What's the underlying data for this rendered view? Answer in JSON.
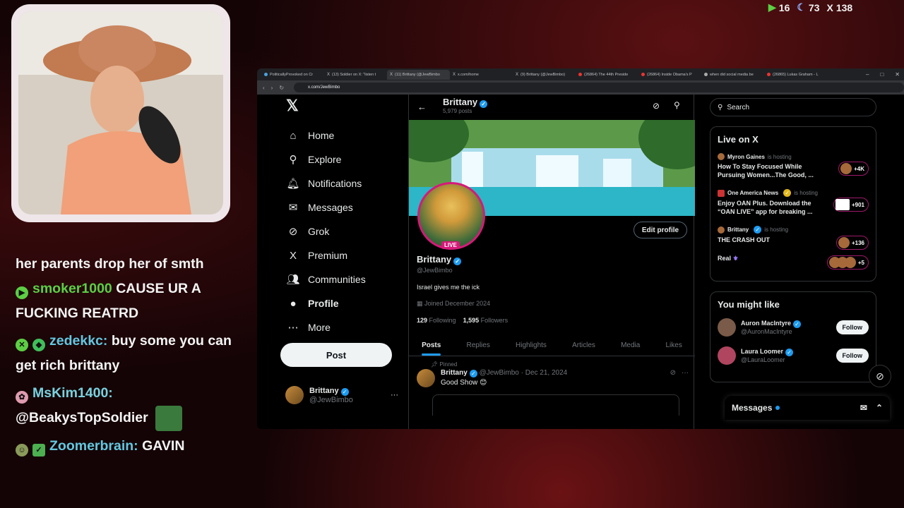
{
  "stats": {
    "a": "16",
    "b": "73",
    "c": "138"
  },
  "chat": [
    {
      "text": "her parents drop her of smth"
    },
    {
      "user": "smoker1000",
      "text": "CAUSE UR A FUCKING REATRD",
      "color": "#5ccf44"
    },
    {
      "user": "zedekkc:",
      "text": "buy some you can get rich brittany",
      "color": "#63c7e0"
    },
    {
      "user": "MsKim1400:",
      "text": "@BeakysTopSoldier",
      "color": "#7ad1de"
    },
    {
      "user": "Zoomerbrain:",
      "text": "GAVIN",
      "color": "#63c7e0"
    }
  ],
  "tabs": [
    "PoliticallyProvoked on Cr",
    "(13) Soldier on X: \"listen t",
    "(11) Brittany (@JewBimbo",
    "x.com/home",
    "(9) Brittany (@JewBimbo)",
    "(26864) The 44th Preside",
    "(26864) Inside Obama's P",
    "when did social media be",
    "(26865) Lukas Graham - L"
  ],
  "url": "x.com/JewBimbo",
  "nav": [
    "Home",
    "Explore",
    "Notifications",
    "Messages",
    "Grok",
    "Premium",
    "Communities",
    "Profile",
    "More"
  ],
  "post_label": "Post",
  "account": {
    "name": "Brittany",
    "handle": "@JewBimbo"
  },
  "profile": {
    "header_name": "Brittany",
    "header_posts": "5,979 posts",
    "live": "LIVE",
    "edit": "Edit profile",
    "name": "Brittany",
    "handle": "@JewBimbo",
    "bio": "Israel gives me the ick",
    "joined": "Joined December 2024",
    "following_n": "129",
    "following_l": "Following",
    "followers_n": "1,595",
    "followers_l": "Followers"
  },
  "ptabs": [
    "Posts",
    "Replies",
    "Highlights",
    "Articles",
    "Media",
    "Likes"
  ],
  "tweet": {
    "pinned": "Pinned",
    "name": "Brittany",
    "meta": "@JewBimbo · Dec 21, 2024",
    "text": "Good Show"
  },
  "search": "Search",
  "live_title": "Live on X",
  "live": [
    {
      "host": "Myron Gaines",
      "is": "is hosting",
      "title": "How To Stay Focused While Pursuing Women...The Good, ...",
      "count": "+4K"
    },
    {
      "host": "One America News",
      "is": "is hosting",
      "title": "Enjoy OAN Plus. Download the “OAN LIVE” app for breaking ...",
      "count": "+901"
    },
    {
      "host": "Brittany",
      "is": "is hosting",
      "title": "THE CRASH OUT",
      "count": "+136"
    },
    {
      "host": "",
      "is": "",
      "title": "Real",
      "count": "+5"
    }
  ],
  "might_like_title": "You might like",
  "suggestions": [
    {
      "name": "Auron MacIntyre",
      "handle": "@AuronMacIntyre",
      "btn": "Follow"
    },
    {
      "name": "Laura Loomer",
      "handle": "@LauraLoomer",
      "btn": "Follow"
    }
  ],
  "messages_label": "Messages"
}
